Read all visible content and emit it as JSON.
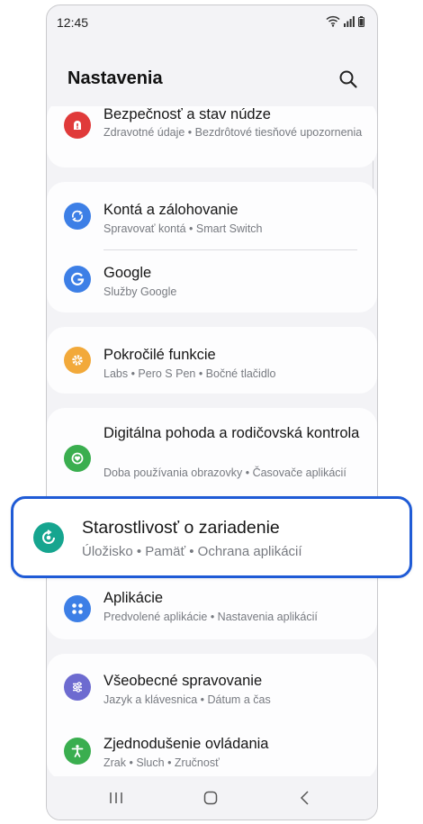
{
  "status": {
    "time": "12:45"
  },
  "header": {
    "title": "Nastavenia"
  },
  "items": [
    {
      "title": "Bezpečnosť a stav núdze",
      "subtitle": "Zdravotné údaje • Bezdrôtové tiesňové upozornenia",
      "icon": "emergency-icon",
      "color": "#e03a3a"
    },
    {
      "title": "Kontá a zálohovanie",
      "subtitle": "Spravovať kontá • Smart Switch",
      "icon": "sync-icon",
      "color": "#3d7fe6"
    },
    {
      "title": "Google",
      "subtitle": "Služby Google",
      "icon": "google-icon",
      "color": "#3d7fe6"
    },
    {
      "title": "Pokročilé funkcie",
      "subtitle": "Labs • Pero S Pen • Bočné tlačidlo",
      "icon": "gear-plus-icon",
      "color": "#f2a93a"
    },
    {
      "title": "Digitálna pohoda a rodičovská kontrola",
      "subtitle": "Doba používania obrazovky • Časovače aplikácií",
      "icon": "wellbeing-icon",
      "color": "#3aae4f"
    },
    {
      "title": "Aplikácie",
      "subtitle": "Predvolené aplikácie • Nastavenia aplikácií",
      "icon": "apps-grid-icon",
      "color": "#3d7fe6"
    },
    {
      "title": "Všeobecné spravovanie",
      "subtitle": "Jazyk a klávesnica • Dátum a čas",
      "icon": "sliders-icon",
      "color": "#6d6bd0"
    },
    {
      "title": "Zjednodušenie ovládania",
      "subtitle": "Zrak • Sluch • Zručnosť",
      "icon": "accessibility-icon",
      "color": "#3aae4f"
    }
  ],
  "highlight": {
    "title": "Starostlivosť o zariadenie",
    "subtitle": "Úložisko  •  Pamäť  •  Ochrana aplikácií",
    "icon": "device-care-icon",
    "color": "#16a58f",
    "border_color": "#1f5bd6"
  }
}
